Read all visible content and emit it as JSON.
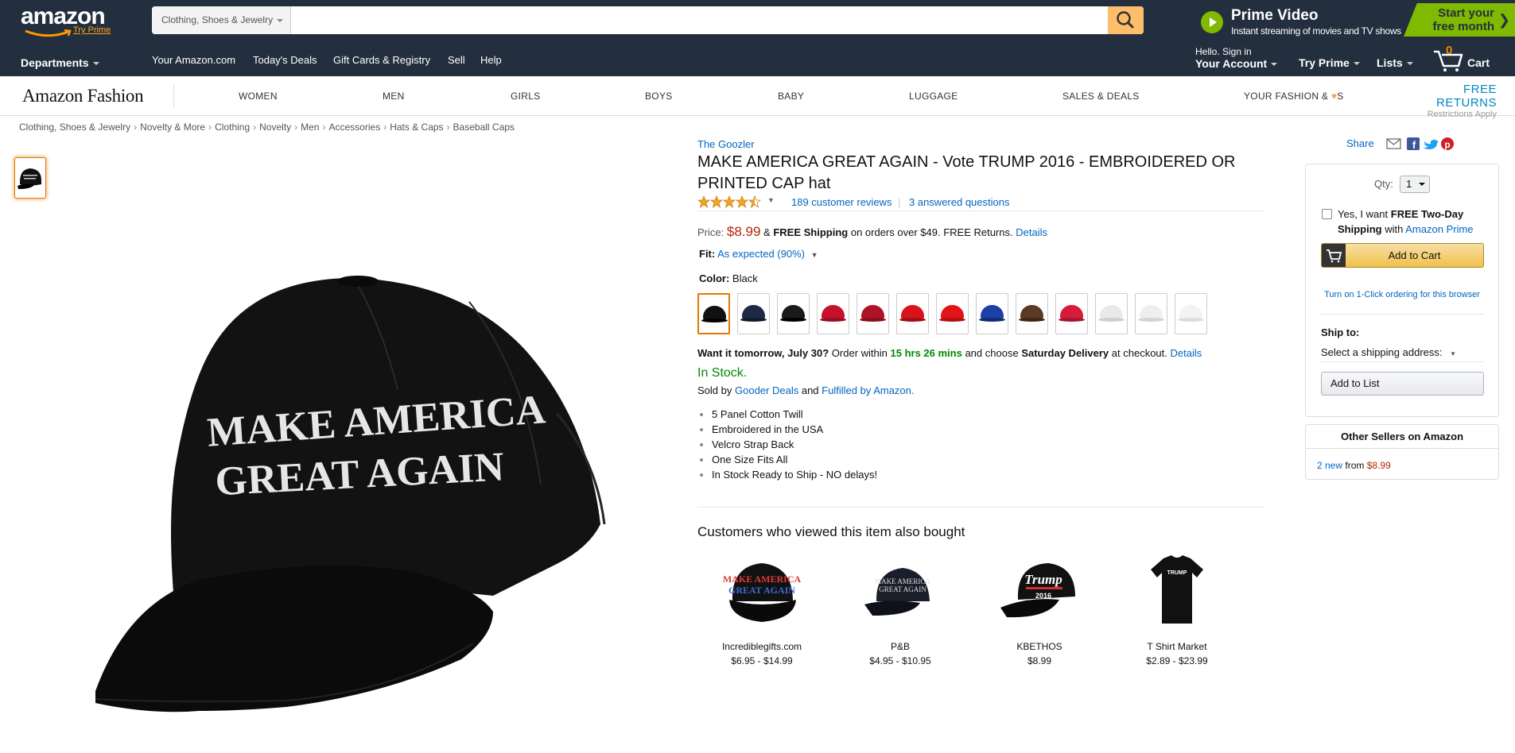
{
  "nav": {
    "logo_text": "amazon",
    "logo_tryprime": "Try Prime",
    "search_scope": "Clothing, Shoes & Jewelry",
    "search_value": "",
    "prime_video_title": "Prime Video",
    "prime_video_sub": "Instant streaming of movies and TV shows",
    "start_trial_line1": "Start your",
    "start_trial_line2": "free month",
    "departments": "Departments",
    "links": [
      "Your Amazon.com",
      "Today's Deals",
      "Gift Cards & Registry",
      "Sell",
      "Help"
    ],
    "account_hello": "Hello. Sign in",
    "account_label": "Your Account",
    "try_prime": "Try Prime",
    "lists": "Lists",
    "cart_count": "0",
    "cart_label": "Cart"
  },
  "fashion": {
    "logo": "Amazon Fashion",
    "items": [
      "WOMEN",
      "MEN",
      "GIRLS",
      "BOYS",
      "BABY",
      "LUGGAGE",
      "SALES & DEALS"
    ],
    "your_fashion_a": "YOUR FASHION &",
    "your_fashion_b": "S",
    "free_returns": "FREE RETURNS",
    "restrictions": "Restrictions Apply"
  },
  "breadcrumb": [
    "Clothing, Shoes & Jewelry",
    "Novelty & More",
    "Clothing",
    "Novelty",
    "Men",
    "Accessories",
    "Hats & Caps",
    "Baseball Caps"
  ],
  "product": {
    "image_text_line1": "MAKE AMERICA",
    "image_text_line2": "GREAT AGAIN",
    "brand": "The Goozler",
    "title": "MAKE AMERICA GREAT AGAIN - Vote TRUMP 2016 - EMBROIDERED OR PRINTED CAP hat",
    "rating": 4.5,
    "reviews": "189 customer reviews",
    "review_sep": "|",
    "answered": "3 answered questions",
    "price_label": "Price:",
    "price": "$8.99",
    "amp": "&",
    "free_shipping": "FREE Shipping",
    "shipping_rest": "on orders over $49. FREE Returns.",
    "details": "Details",
    "fit_label": "Fit:",
    "fit_value": "As expected (90%)",
    "color_label": "Color:",
    "color_value": "Black",
    "swatches": [
      {
        "cap": "#111111",
        "brim": "#000000"
      },
      {
        "cap": "#1c2a44",
        "brim": "#0f1a2e"
      },
      {
        "cap": "#1a1a1a",
        "brim": "#000000"
      },
      {
        "cap": "#c8102e",
        "brim": "#9a0c22"
      },
      {
        "cap": "#b01228",
        "brim": "#8a0d1f"
      },
      {
        "cap": "#d9121b",
        "brim": "#a30d14"
      },
      {
        "cap": "#e01419",
        "brim": "#b00f14"
      },
      {
        "cap": "#1d3fa8",
        "brim": "#122a78"
      },
      {
        "cap": "#5a3a22",
        "brim": "#3d2714"
      },
      {
        "cap": "#d81b3a",
        "brim": "#a8142c"
      },
      {
        "cap": "#e9e9e9",
        "brim": "#cfcfcf"
      },
      {
        "cap": "#eeeeee",
        "brim": "#d4d4d4"
      },
      {
        "cap": "#f3f3f3",
        "brim": "#dcdcdc"
      }
    ],
    "delivery_a": "Want it tomorrow, July 30?",
    "delivery_b": "Order within",
    "delivery_time": "15 hrs 26 mins",
    "delivery_c": "and choose",
    "delivery_d": "Saturday Delivery",
    "delivery_e": "at checkout.",
    "delivery_details": "Details",
    "in_stock": "In Stock.",
    "sold_by_a": "Sold by",
    "seller": "Gooder Deals",
    "sold_by_and": "and",
    "fulfilled": "Fulfilled by Amazon.",
    "bullets": [
      "5 Panel Cotton Twill",
      "Embroidered in the USA",
      "Velcro Strap Back",
      "One Size Fits All",
      "In Stock Ready to Ship - NO delays!"
    ]
  },
  "also_bought": {
    "title": "Customers who viewed this item also bought",
    "items": [
      {
        "name": "Incrediblegifts.com",
        "price": "$6.95 - $14.99",
        "img_text1": "MAKE AMERICA",
        "img_text2": "GREAT AGAIN"
      },
      {
        "name": "P&B",
        "price": "$4.95 - $10.95",
        "img_text1": "MAKE AMERICA",
        "img_text2": "GREAT AGAIN"
      },
      {
        "name": "KBETHOS",
        "price": "$8.99",
        "img_text1": "Trump",
        "img_text2": "2016"
      },
      {
        "name": "T Shirt Market",
        "price": "$2.89 - $23.99",
        "img_text1": "TRUMP",
        "img_text2": ""
      }
    ]
  },
  "buybox": {
    "share": "Share",
    "qty_label": "Qty:",
    "qty_value": "1",
    "prime_a": "Yes, I want",
    "prime_b": "FREE Two-Day Shipping",
    "prime_c": "with",
    "prime_link": "Amazon Prime",
    "add_to_cart": "Add to Cart",
    "one_click": "Turn on 1-Click ordering for this browser",
    "ship_to": "Ship to:",
    "ship_address": "Select a shipping address:",
    "add_to_list": "Add to List",
    "other_sellers_title": "Other Sellers on Amazon",
    "other_new": "2 new",
    "other_from": "from",
    "other_price": "$8.99"
  },
  "colors": {
    "nav_bg": "#232f3e",
    "price": "#b12704",
    "link": "#0066c0",
    "in_stock": "#008a00",
    "accent": "#febd69",
    "prime_green": "#7fba00"
  }
}
